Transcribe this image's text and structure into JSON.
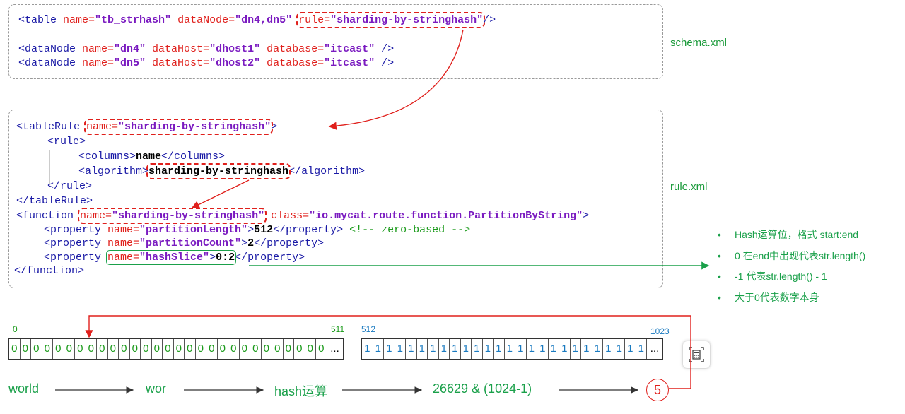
{
  "schema_code": {
    "line1": {
      "open": "<table ",
      "a1": "name=",
      "v1": "\"tb_strhash\"",
      "a2": " dataNode=",
      "v2": "\"dn4,dn5\"",
      "a3": "rule=",
      "v3": "\"sharding-by-stringhash\"",
      "close": "/>"
    },
    "line2": {
      "open": "<dataNode ",
      "a1": "name=",
      "v1": "\"dn4\"",
      "a2": " dataHost=",
      "v2": "\"dhost1\"",
      "a3": " database=",
      "v3": "\"itcast\"",
      "close": " />"
    },
    "line3": {
      "open": "<dataNode ",
      "a1": "name=",
      "v1": "\"dn5\"",
      "a2": " dataHost=",
      "v2": "\"dhost2\"",
      "a3": " database=",
      "v3": "\"itcast\"",
      "close": " />"
    }
  },
  "rule_code": {
    "l1": {
      "open": "<tableRule ",
      "a1": "name=",
      "v1": "\"sharding-by-stringhash\"",
      "close": ">"
    },
    "l2": "<rule>",
    "l3": {
      "open": "<columns>",
      "val": "name",
      "close": "</columns>"
    },
    "l4": {
      "open": "<algorithm>",
      "val": "sharding-by-stringhash",
      "close": "</algorithm>"
    },
    "l5": "</rule>",
    "l6": "</tableRule>",
    "l7": {
      "open": "<function ",
      "a1": "name=",
      "v1": "\"sharding-by-stringhash\"",
      "a2": " class=",
      "v2": "\"io.mycat.route.function.PartitionByString\"",
      "close": ">"
    },
    "l8": {
      "open": "<property ",
      "a1": "name=",
      "v1": "\"partitionLength\"",
      "mid": ">",
      "val": "512",
      "close": "</property> ",
      "cmt": "<!-- zero-based -->"
    },
    "l9": {
      "open": "<property ",
      "a1": "name=",
      "v1": "\"partitionCount\"",
      "mid": ">",
      "val": "2",
      "close": "</property>"
    },
    "l10": {
      "open": "<property ",
      "a1": "name=",
      "v1": "\"hashSlice\"",
      "mid": ">",
      "val": "0:2",
      "close": "</property>"
    },
    "l11": "</function>"
  },
  "labels": {
    "schema": "schema.xml",
    "rule": "rule.xml"
  },
  "bullets": [
    "Hash运算位，格式 start:end",
    "0 在end中出现代表str.length()",
    "-1 代表str.length() - 1",
    "大于0代表数字本身"
  ],
  "bullet_glyph": "•",
  "array": {
    "zero_cell": "0",
    "one_cell": "1",
    "ellipsis": "...",
    "idx_0": "0",
    "idx_511": "511",
    "idx_512": "512",
    "idx_1023": "1023"
  },
  "flow": {
    "s1": "world",
    "s2": "wor",
    "s3": "hash运算",
    "s4": "26629 & (1024-1)",
    "result": "5"
  },
  "colors": {
    "green": "#1aa04a",
    "red": "#e0201c",
    "blue": "#1a7ac0",
    "purple": "#7a1ac0",
    "tag": "#1a1aa6"
  }
}
